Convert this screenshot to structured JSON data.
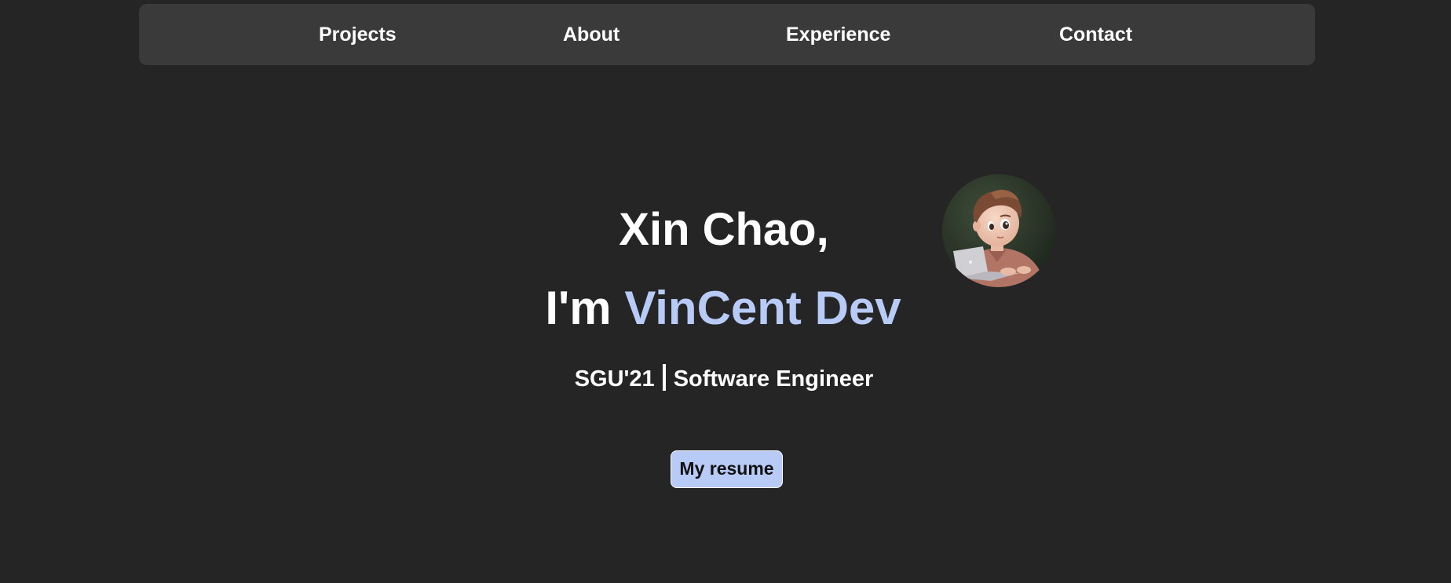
{
  "nav": {
    "items": [
      {
        "label": "Projects"
      },
      {
        "label": "About"
      },
      {
        "label": "Experience"
      },
      {
        "label": "Contact"
      }
    ]
  },
  "hero": {
    "greeting": "Xin Chao,",
    "intro_prefix": "I'm",
    "name": "VinCent Dev",
    "subtitle_left": "SGU'21",
    "subtitle_right": "Software Engineer",
    "resume_label": "My resume",
    "avatar": "cartoon-boy-with-laptop-avatar"
  },
  "colors": {
    "background": "#252525",
    "navbar": "#3a3a3a",
    "accent": "#b7cbf6",
    "text": "#ffffff"
  }
}
